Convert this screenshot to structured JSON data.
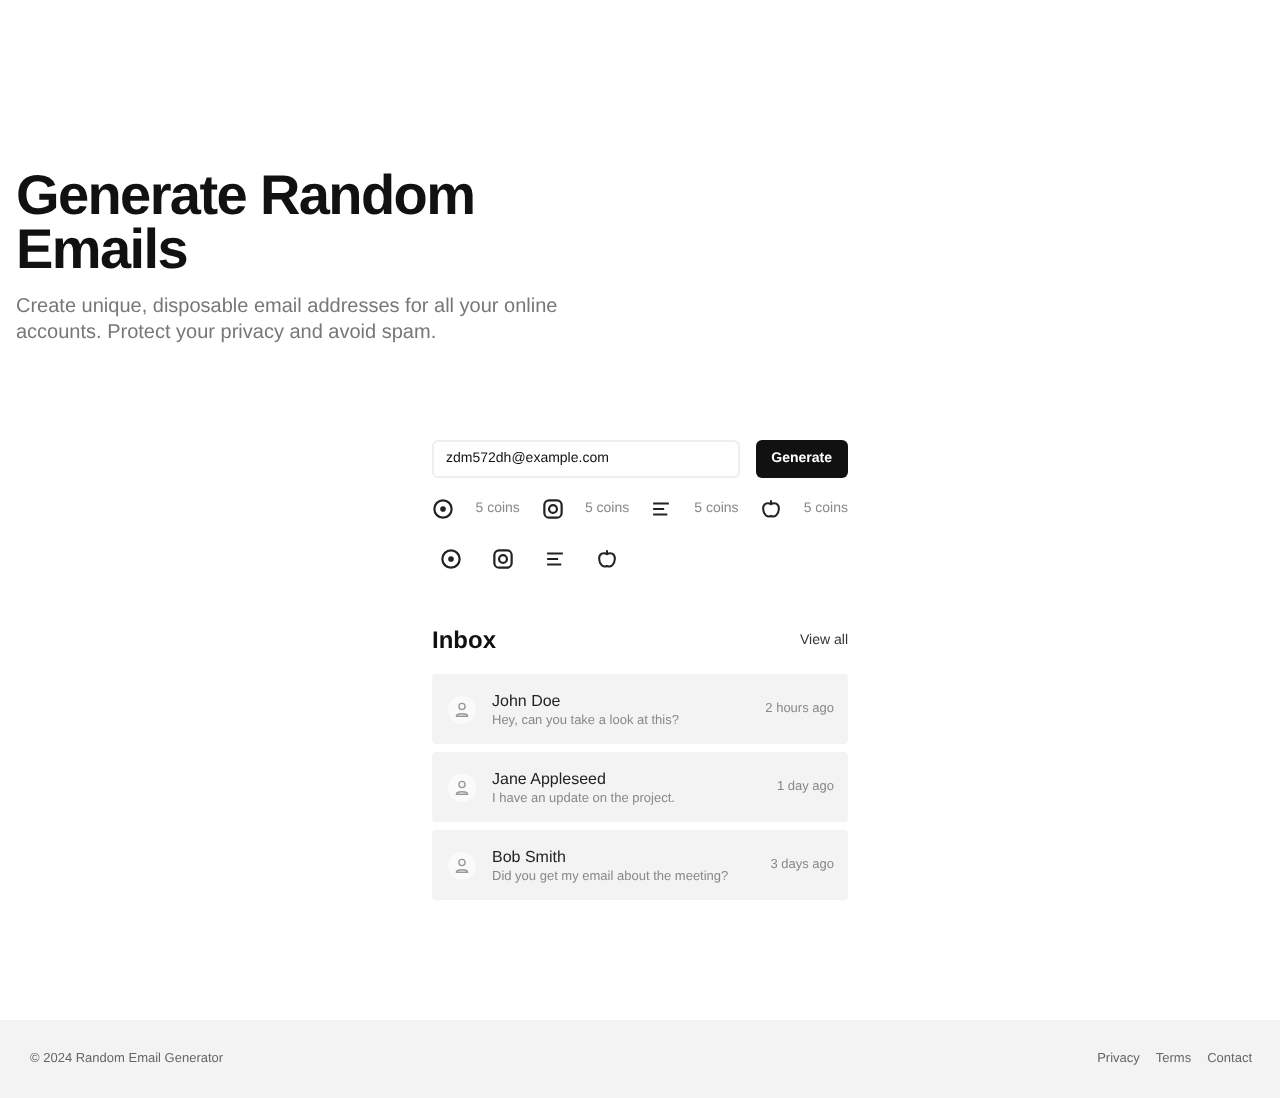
{
  "hero": {
    "title": "Generate Random Emails",
    "subtitle": "Create unique, disposable email addresses for all your online accounts. Protect your privacy and avoid spam."
  },
  "generator": {
    "email": "zdm572dh@example.com",
    "button": "Generate"
  },
  "services": [
    {
      "kind": "target",
      "coins": "5 coins"
    },
    {
      "kind": "camera",
      "coins": "5 coins"
    },
    {
      "kind": "lines",
      "coins": "5 coins"
    },
    {
      "kind": "apple",
      "coins": "5 coins"
    }
  ],
  "quick_icons": [
    {
      "kind": "target"
    },
    {
      "kind": "camera"
    },
    {
      "kind": "lines"
    },
    {
      "kind": "apple"
    }
  ],
  "inbox": {
    "title": "Inbox",
    "view_all": "View all",
    "messages": [
      {
        "sender": "John Doe",
        "preview": "Hey, can you take a look at this?",
        "time": "2 hours ago"
      },
      {
        "sender": "Jane Appleseed",
        "preview": "I have an update on the project.",
        "time": "1 day ago"
      },
      {
        "sender": "Bob Smith",
        "preview": "Did you get my email about the meeting?",
        "time": "3 days ago"
      }
    ]
  },
  "footer": {
    "copyright": "© 2024 Random Email Generator",
    "links": [
      "Privacy",
      "Terms",
      "Contact"
    ]
  }
}
